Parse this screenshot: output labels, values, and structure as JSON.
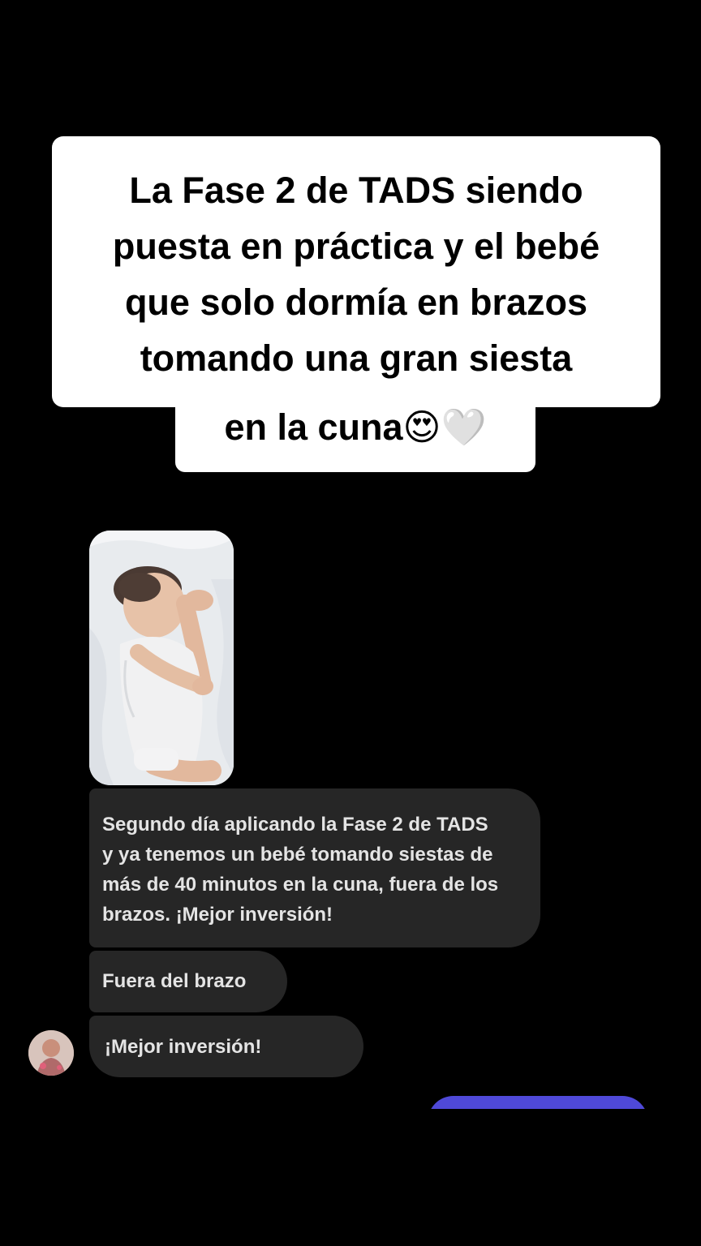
{
  "caption": {
    "lines": [
      "La Fase 2 de TADS siendo",
      "puesta en práctica y el bebé",
      "que solo dormía en brazos",
      "tomando una gran siesta"
    ],
    "last_line": "en la cuna😍🤍"
  },
  "chat": {
    "photo_icon": "sleeping-baby-photo",
    "messages": [
      {
        "lines": [
          "Segundo día aplicando la Fase 2 de TADS",
          "y ya tenemos un bebé tomando siestas de",
          "más de 40 minutos en la cuna, fuera de los",
          "brazos. ¡Mejor inversión!"
        ]
      },
      {
        "text": "Fuera del brazo"
      },
      {
        "text": "¡Mejor inversión!"
      }
    ],
    "avatar_icon": "sender-avatar",
    "outgoing_color": "#4f49d8"
  },
  "colors": {
    "background": "#000000",
    "caption_bg": "#ffffff",
    "bubble_bg": "#262626",
    "bubble_text": "#e4e4e4"
  }
}
